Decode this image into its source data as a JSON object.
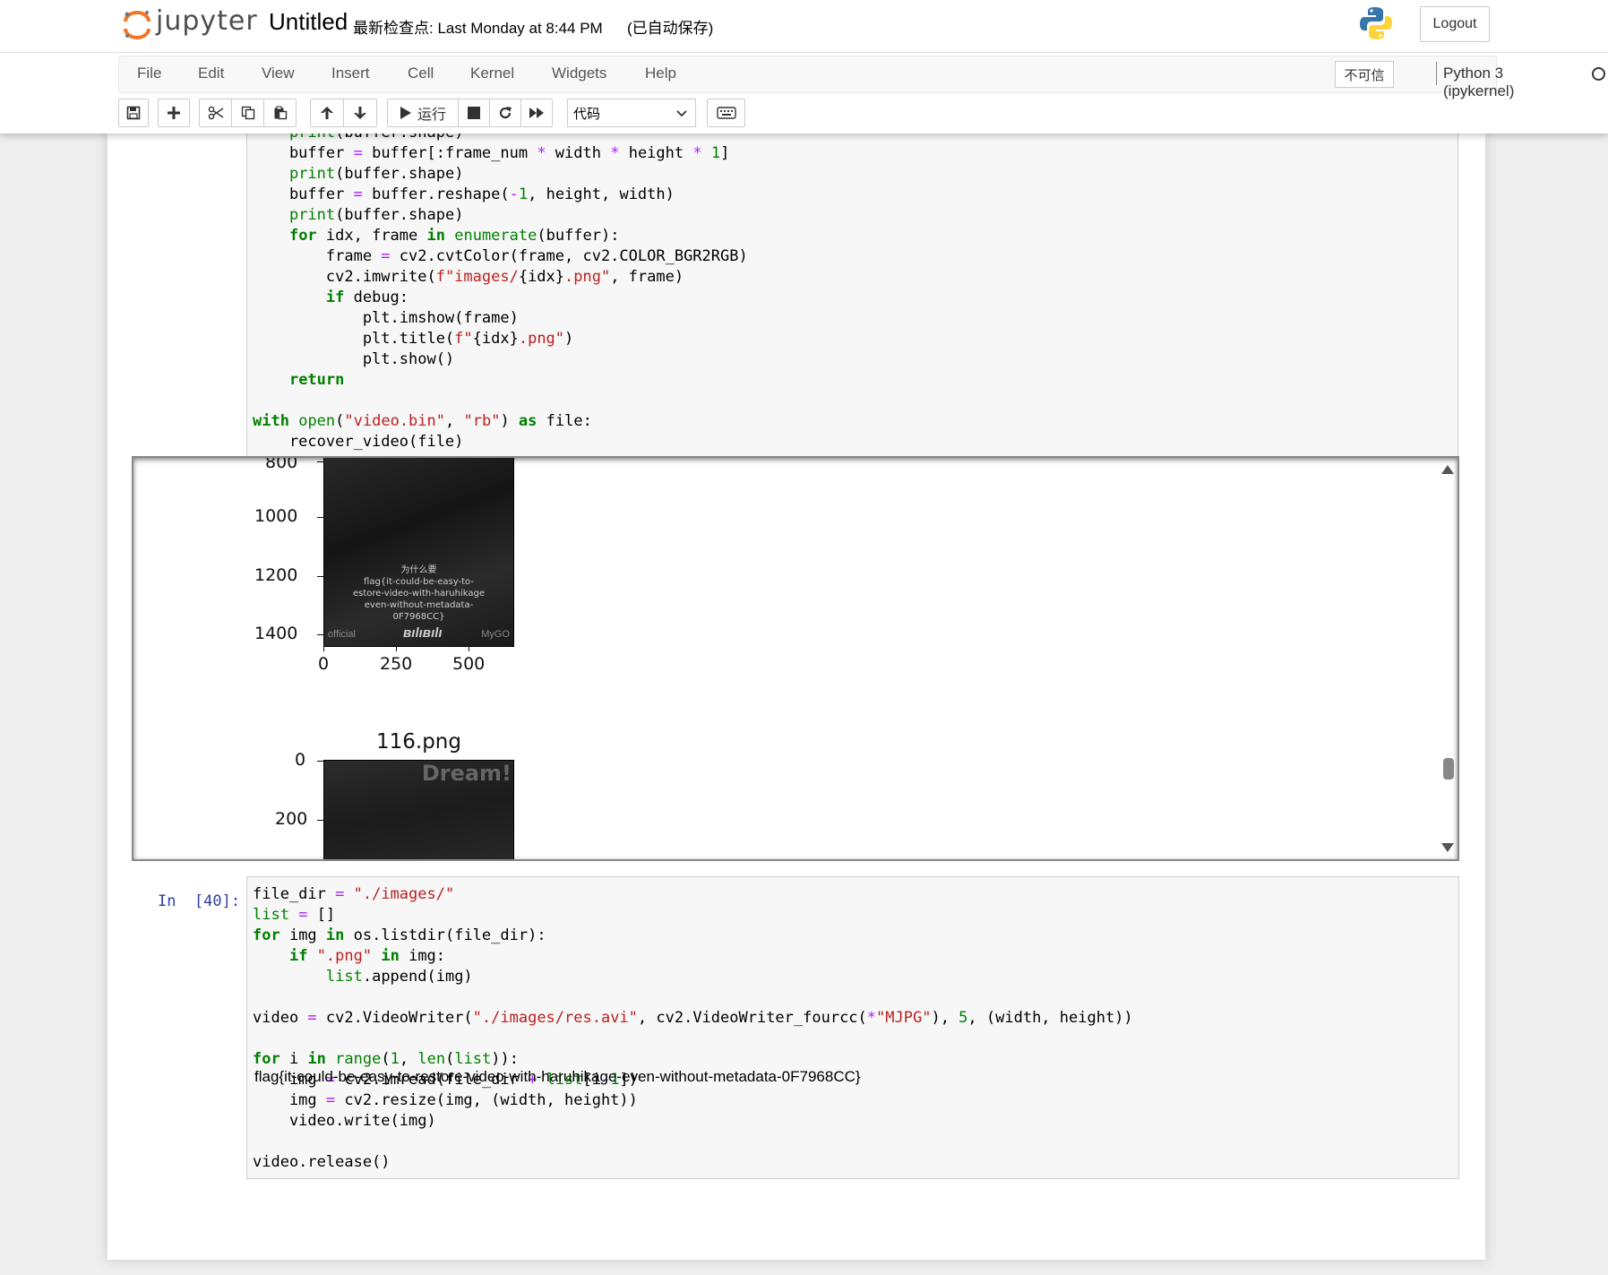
{
  "header": {
    "logo_text": "jupyter",
    "notebook_title": "Untitled",
    "checkpoint": "最新检查点: Last Monday at 8:44 PM",
    "autosave": "(已自动保存)",
    "logout_label": "Logout"
  },
  "menubar": {
    "items": [
      "File",
      "Edit",
      "View",
      "Insert",
      "Cell",
      "Kernel",
      "Widgets",
      "Help"
    ],
    "trusted_label": "不可信",
    "kernel_name": "Python 3 (ipykernel)"
  },
  "toolbar": {
    "run_label": "运行",
    "cell_type": "代码"
  },
  "output": {
    "plot1_yticks": [
      "800",
      "1000",
      "1200",
      "1400"
    ],
    "plot1_xticks": [
      "0",
      "250",
      "500"
    ],
    "plot1_overlay": [
      "为什么要",
      "flag{it-could-be-easy-to-",
      "estore-video-with-haruhikage",
      "even-without-metadata-",
      "0F7968CC}"
    ],
    "plot1_footer_left": "official",
    "plot1_footer_right": "MyGO",
    "plot2_title": "116.png",
    "plot2_yticks": [
      "0",
      "200"
    ],
    "plot2_watermark": "Dream!"
  },
  "cell2": {
    "prompt": "In  [40]:"
  },
  "flag_output": "flag{it-could-be-easy-to-restore-video-with-haruhikage-even-without-metadata-0F7968CC}"
}
